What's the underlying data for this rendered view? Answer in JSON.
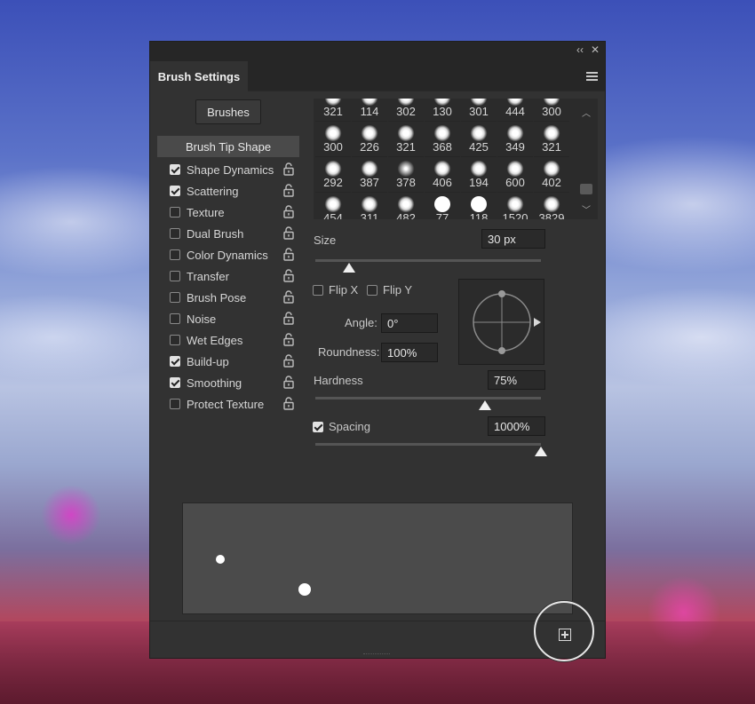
{
  "panel": {
    "title": "Brush Settings",
    "brushes_button": "Brushes",
    "collapse_glyph": "‹‹",
    "close_glyph": "✕"
  },
  "options": {
    "header": "Brush Tip Shape",
    "items": [
      {
        "label": "Shape Dynamics",
        "checked": true
      },
      {
        "label": "Scattering",
        "checked": true
      },
      {
        "label": "Texture",
        "checked": false
      },
      {
        "label": "Dual Brush",
        "checked": false
      },
      {
        "label": "Color Dynamics",
        "checked": false
      },
      {
        "label": "Transfer",
        "checked": false
      },
      {
        "label": "Brush Pose",
        "checked": false
      },
      {
        "label": "Noise",
        "checked": false
      },
      {
        "label": "Wet Edges",
        "checked": false
      },
      {
        "label": "Build-up",
        "checked": true
      },
      {
        "label": "Smoothing",
        "checked": true
      },
      {
        "label": "Protect Texture",
        "checked": false
      }
    ]
  },
  "brush_grid": {
    "rows": [
      [
        "321",
        "114",
        "302",
        "130",
        "301",
        "444",
        "300"
      ],
      [
        "300",
        "226",
        "321",
        "368",
        "425",
        "349",
        "321"
      ],
      [
        "292",
        "387",
        "378",
        "406",
        "194",
        "600",
        "402"
      ],
      [
        "454",
        "311",
        "482",
        "77",
        "118",
        "1520",
        "3829"
      ]
    ]
  },
  "tip_shape": {
    "size_label": "Size",
    "size_value": "30 px",
    "size_slider_fraction": 0.15,
    "flip_x_label": "Flip X",
    "flip_y_label": "Flip Y",
    "angle_label": "Angle:",
    "angle_value": "0°",
    "roundness_label": "Roundness:",
    "roundness_value": "100%",
    "hardness_label": "Hardness",
    "hardness_value": "75%",
    "hardness_slider_fraction": 0.75,
    "spacing_label": "Spacing",
    "spacing_value": "1000%",
    "spacing_checked": true,
    "spacing_slider_fraction": 1.0
  },
  "colors": {
    "panel_bg": "#323232",
    "field_bg": "#2a2a2a",
    "text": "#d6d6d6"
  }
}
